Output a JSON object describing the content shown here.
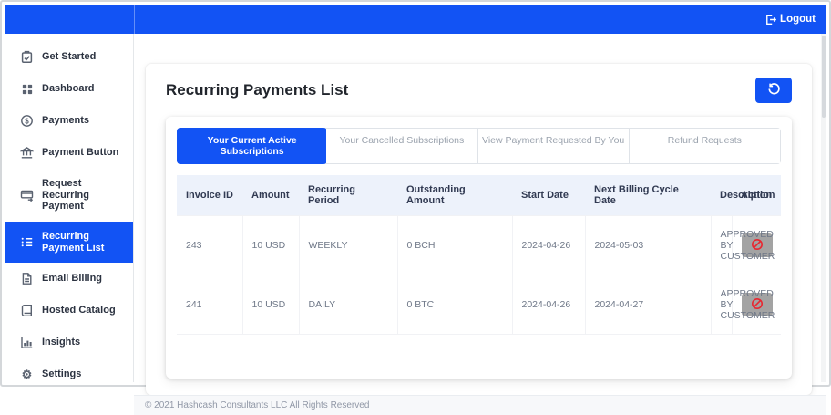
{
  "colors": {
    "primary": "#1253f4",
    "danger": "#e82731",
    "action_button_bg": "#a3a3a3",
    "table_header_bg": "#edf2fb"
  },
  "topbar": {
    "logout_label": "Logout"
  },
  "sidebar": {
    "items": [
      {
        "label": "Get Started",
        "icon": "clipboard-check-icon",
        "active": false
      },
      {
        "label": "Dashboard",
        "icon": "grid-icon",
        "active": false
      },
      {
        "label": "Payments",
        "icon": "dollar-circle-icon",
        "active": false
      },
      {
        "label": "Payment Button",
        "icon": "bank-icon",
        "active": false
      },
      {
        "label": "Request Recurring Payment",
        "icon": "card-arrow-icon",
        "active": false
      },
      {
        "label": "Recurring Payment List",
        "icon": "list-icon",
        "active": true
      },
      {
        "label": "Email Billing",
        "icon": "document-icon",
        "active": false
      },
      {
        "label": "Hosted Catalog",
        "icon": "book-icon",
        "active": false
      },
      {
        "label": "Insights",
        "icon": "chart-icon",
        "active": false
      },
      {
        "label": "Settings",
        "icon": "gear-icon",
        "active": false
      }
    ]
  },
  "main": {
    "title": "Recurring Payments List",
    "tabs": [
      {
        "label": "Your Current Active Subscriptions",
        "active": true
      },
      {
        "label": "Your Cancelled Subscriptions",
        "active": false
      },
      {
        "label": "View Payment Requested By You",
        "active": false
      },
      {
        "label": "Refund Requests",
        "active": false
      }
    ],
    "table": {
      "columns": [
        "Invoice ID",
        "Amount",
        "Recurring Period",
        "Outstanding Amount",
        "Start Date",
        "Next Billing Cycle Date",
        "Description",
        "Action"
      ],
      "rows": [
        {
          "cells": [
            "243",
            "10 USD",
            "WEEKLY",
            "0 BCH",
            "2024-04-26",
            "2024-05-03",
            "APPROVED BY CUSTOMER"
          ],
          "action_icon": "cancel-icon"
        },
        {
          "cells": [
            "241",
            "10 USD",
            "DAILY",
            "0 BTC",
            "2024-04-26",
            "2024-04-27",
            "APPROVED BY CUSTOMER"
          ],
          "action_icon": "cancel-icon"
        }
      ]
    }
  },
  "footer": {
    "copyright": "© 2021 Hashcash Consultants LLC All Rights Reserved"
  }
}
